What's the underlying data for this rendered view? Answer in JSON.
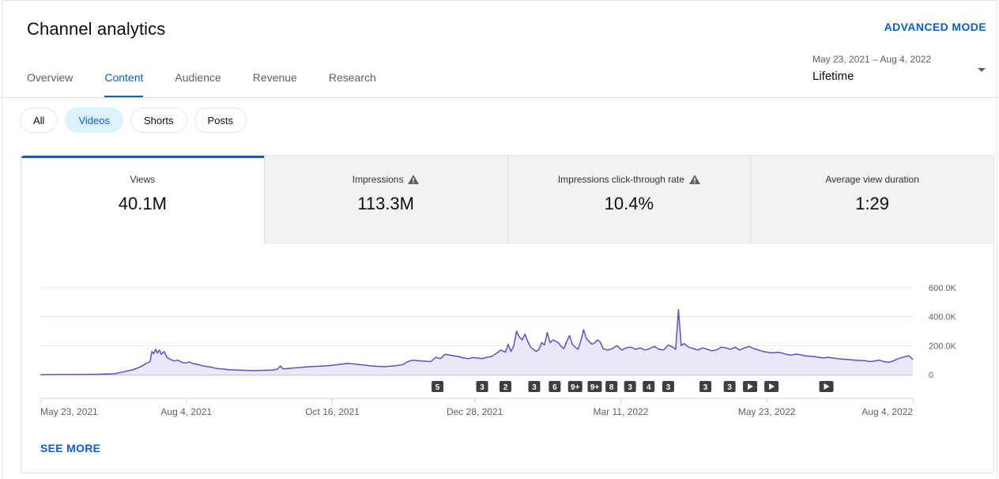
{
  "header": {
    "title": "Channel analytics",
    "advanced_mode": "ADVANCED MODE"
  },
  "tabs": [
    "Overview",
    "Content",
    "Audience",
    "Revenue",
    "Research"
  ],
  "active_tab": "Content",
  "date_range": {
    "dates": "May 23, 2021 – Aug 4, 2022",
    "label": "Lifetime"
  },
  "filters": {
    "chips": [
      "All",
      "Videos",
      "Shorts",
      "Posts"
    ],
    "active": "Videos"
  },
  "metrics": [
    {
      "label": "Views",
      "value": "40.1M",
      "warning": false
    },
    {
      "label": "Impressions",
      "value": "113.3M",
      "warning": true
    },
    {
      "label": "Impressions click-through rate",
      "value": "10.4%",
      "warning": true
    },
    {
      "label": "Average view duration",
      "value": "1:29",
      "warning": false
    }
  ],
  "colors": {
    "accent": "#065fd4",
    "line": "#5b4fcf",
    "area": "#eae8f8"
  },
  "chart_data": {
    "type": "area",
    "series": [
      {
        "values": [
          [
            0,
            0
          ],
          [
            14,
            1
          ],
          [
            28,
            1
          ],
          [
            42,
            2
          ],
          [
            56,
            2
          ],
          [
            70,
            4
          ],
          [
            80,
            6
          ],
          [
            90,
            20
          ],
          [
            100,
            35
          ],
          [
            108,
            55
          ],
          [
            113,
            75
          ],
          [
            118,
            90
          ],
          [
            120,
            160
          ],
          [
            122,
            145
          ],
          [
            124,
            175
          ],
          [
            126,
            150
          ],
          [
            128,
            170
          ],
          [
            130,
            140
          ],
          [
            133,
            160
          ],
          [
            136,
            120
          ],
          [
            140,
            105
          ],
          [
            144,
            95
          ],
          [
            148,
            100
          ],
          [
            152,
            85
          ],
          [
            156,
            80
          ],
          [
            160,
            88
          ],
          [
            165,
            75
          ],
          [
            170,
            70
          ],
          [
            175,
            60
          ],
          [
            180,
            55
          ],
          [
            185,
            50
          ],
          [
            190,
            42
          ],
          [
            196,
            40
          ],
          [
            202,
            35
          ],
          [
            210,
            32
          ],
          [
            220,
            30
          ],
          [
            230,
            28
          ],
          [
            240,
            30
          ],
          [
            250,
            32
          ],
          [
            255,
            38
          ],
          [
            258,
            60
          ],
          [
            261,
            40
          ],
          [
            270,
            45
          ],
          [
            280,
            50
          ],
          [
            290,
            55
          ],
          [
            300,
            58
          ],
          [
            310,
            62
          ],
          [
            320,
            70
          ],
          [
            330,
            78
          ],
          [
            340,
            72
          ],
          [
            350,
            65
          ],
          [
            360,
            58
          ],
          [
            370,
            55
          ],
          [
            380,
            60
          ],
          [
            390,
            70
          ],
          [
            395,
            90
          ],
          [
            400,
            100
          ],
          [
            410,
            95
          ],
          [
            420,
            90
          ],
          [
            425,
            120
          ],
          [
            430,
            110
          ],
          [
            435,
            140
          ],
          [
            440,
            135
          ],
          [
            445,
            130
          ],
          [
            450,
            125
          ],
          [
            455,
            115
          ],
          [
            460,
            110
          ],
          [
            465,
            118
          ],
          [
            470,
            115
          ],
          [
            475,
            110
          ],
          [
            480,
            120
          ],
          [
            485,
            125
          ],
          [
            490,
            145
          ],
          [
            495,
            170
          ],
          [
            500,
            155
          ],
          [
            503,
            210
          ],
          [
            506,
            160
          ],
          [
            509,
            200
          ],
          [
            512,
            300
          ],
          [
            515,
            260
          ],
          [
            518,
            240
          ],
          [
            521,
            280
          ],
          [
            524,
            230
          ],
          [
            527,
            190
          ],
          [
            530,
            175
          ],
          [
            533,
            160
          ],
          [
            536,
            175
          ],
          [
            539,
            220
          ],
          [
            542,
            205
          ],
          [
            545,
            290
          ],
          [
            548,
            220
          ],
          [
            551,
            240
          ],
          [
            554,
            230
          ],
          [
            557,
            220
          ],
          [
            560,
            195
          ],
          [
            563,
            180
          ],
          [
            566,
            230
          ],
          [
            569,
            270
          ],
          [
            572,
            210
          ],
          [
            575,
            190
          ],
          [
            578,
            175
          ],
          [
            581,
            230
          ],
          [
            584,
            310
          ],
          [
            587,
            250
          ],
          [
            590,
            230
          ],
          [
            593,
            210
          ],
          [
            596,
            220
          ],
          [
            599,
            240
          ],
          [
            602,
            225
          ],
          [
            605,
            180
          ],
          [
            610,
            170
          ],
          [
            615,
            180
          ],
          [
            620,
            200
          ],
          [
            625,
            170
          ],
          [
            630,
            185
          ],
          [
            635,
            190
          ],
          [
            640,
            175
          ],
          [
            645,
            185
          ],
          [
            650,
            170
          ],
          [
            655,
            180
          ],
          [
            660,
            195
          ],
          [
            665,
            175
          ],
          [
            670,
            170
          ],
          [
            675,
            205
          ],
          [
            680,
            190
          ],
          [
            683,
            175
          ],
          [
            686,
            450
          ],
          [
            689,
            200
          ],
          [
            692,
            215
          ],
          [
            697,
            190
          ],
          [
            702,
            180
          ],
          [
            707,
            170
          ],
          [
            712,
            185
          ],
          [
            717,
            175
          ],
          [
            722,
            165
          ],
          [
            727,
            170
          ],
          [
            732,
            190
          ],
          [
            737,
            185
          ],
          [
            742,
            175
          ],
          [
            747,
            190
          ],
          [
            752,
            170
          ],
          [
            757,
            185
          ],
          [
            762,
            195
          ],
          [
            767,
            180
          ],
          [
            772,
            170
          ],
          [
            777,
            160
          ],
          [
            782,
            155
          ],
          [
            787,
            150
          ],
          [
            792,
            155
          ],
          [
            797,
            150
          ],
          [
            802,
            140
          ],
          [
            807,
            135
          ],
          [
            812,
            142
          ],
          [
            817,
            138
          ],
          [
            822,
            130
          ],
          [
            827,
            128
          ],
          [
            832,
            125
          ],
          [
            837,
            120
          ],
          [
            842,
            115
          ],
          [
            847,
            120
          ],
          [
            852,
            115
          ],
          [
            857,
            110
          ],
          [
            862,
            108
          ],
          [
            867,
            105
          ],
          [
            872,
            102
          ],
          [
            877,
            100
          ],
          [
            882,
            98
          ],
          [
            887,
            96
          ],
          [
            892,
            90
          ],
          [
            897,
            95
          ],
          [
            902,
            100
          ],
          [
            907,
            90
          ],
          [
            912,
            85
          ],
          [
            917,
            95
          ],
          [
            922,
            110
          ],
          [
            927,
            120
          ],
          [
            930,
            125
          ],
          [
            934,
            130
          ],
          [
            938,
            105
          ]
        ]
      }
    ],
    "x_range": [
      0,
      938
    ],
    "x_ticks": [
      {
        "x": 0,
        "label": "May 23, 2021"
      },
      {
        "x": 157,
        "label": "Aug 4, 2021"
      },
      {
        "x": 314,
        "label": "Oct 16, 2021"
      },
      {
        "x": 467,
        "label": "Dec 28, 2021"
      },
      {
        "x": 624,
        "label": "Mar 11, 2022"
      },
      {
        "x": 781,
        "label": "May 23, 2022"
      },
      {
        "x": 938,
        "label": "Aug 4, 2022"
      }
    ],
    "y_ticks": [
      {
        "y": 0,
        "label": "0"
      },
      {
        "y": 200,
        "label": "200.0K"
      },
      {
        "y": 400,
        "label": "400.0K"
      },
      {
        "y": 600,
        "label": "600.0K"
      }
    ],
    "ylim": [
      0,
      600
    ],
    "grid": true,
    "markers": [
      {
        "x": 427,
        "label": "5"
      },
      {
        "x": 475,
        "label": "3"
      },
      {
        "x": 500,
        "label": "2"
      },
      {
        "x": 531,
        "label": "3"
      },
      {
        "x": 553,
        "label": "6"
      },
      {
        "x": 575,
        "label": "9+"
      },
      {
        "x": 596,
        "label": "9+"
      },
      {
        "x": 614,
        "label": "8"
      },
      {
        "x": 634,
        "label": "3"
      },
      {
        "x": 654,
        "label": "4"
      },
      {
        "x": 675,
        "label": "3"
      },
      {
        "x": 715,
        "label": "3"
      },
      {
        "x": 741,
        "label": "3"
      },
      {
        "x": 763,
        "label": "play"
      },
      {
        "x": 786,
        "label": "play"
      },
      {
        "x": 845,
        "label": "play"
      }
    ]
  },
  "see_more": "SEE MORE"
}
